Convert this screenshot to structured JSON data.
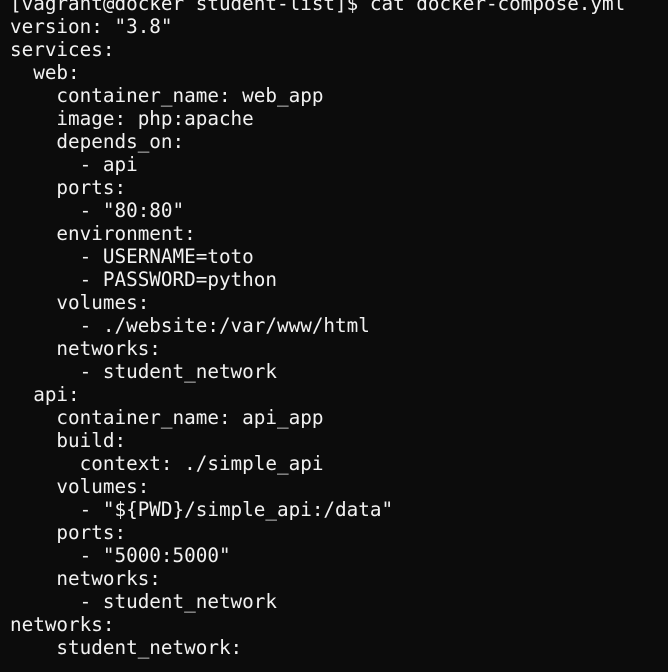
{
  "terminal": {
    "lines": [
      "[vagrant@docker student-list]$ cat docker-compose.yml",
      "version: \"3.8\"",
      "services:",
      "  web:",
      "    container_name: web_app",
      "    image: php:apache",
      "    depends_on:",
      "      - api",
      "    ports:",
      "      - \"80:80\"",
      "    environment:",
      "      - USERNAME=toto",
      "      - PASSWORD=python",
      "    volumes:",
      "      - ./website:/var/www/html",
      "    networks:",
      "      - student_network",
      "  api:",
      "    container_name: api_app",
      "    build:",
      "      context: ./simple_api",
      "    volumes:",
      "      - \"${PWD}/simple_api:/data\"",
      "    ports:",
      "      - \"5000:5000\"",
      "    networks:",
      "      - student_network",
      "networks:",
      "    student_network:"
    ],
    "colors": {
      "background": "#0c0c0c",
      "foreground": "#f2f2f2"
    }
  }
}
